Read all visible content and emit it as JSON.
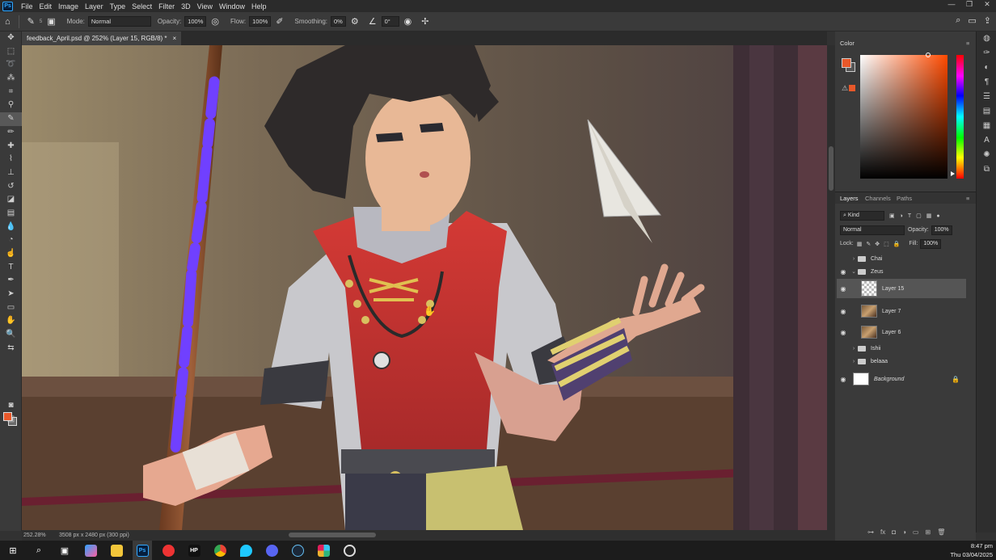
{
  "app": {
    "logo": "Ps"
  },
  "menu": [
    "File",
    "Edit",
    "Image",
    "Layer",
    "Type",
    "Select",
    "Filter",
    "3D",
    "View",
    "Window",
    "Help"
  ],
  "window_controls": [
    "—",
    "❐",
    "✕"
  ],
  "options": {
    "mode_label": "Mode:",
    "mode_value": "Normal",
    "opacity_label": "Opacity:",
    "opacity_value": "100%",
    "flow_label": "Flow:",
    "flow_value": "100%",
    "smoothing_label": "Smoothing:",
    "smoothing_value": "0%",
    "angle_value": "0°",
    "brush_size": "5"
  },
  "document": {
    "tab_title": "feedback_April.psd @ 252% (Layer 15, RGB/8) *",
    "close": "×"
  },
  "status": {
    "zoom": "252.28%",
    "dims": "3508 px x 2480 px (300 ppi)"
  },
  "color_panel": {
    "title": "Color",
    "foreground": "#e8582a",
    "hue": "#ff4a00"
  },
  "layers_panel": {
    "tabs": [
      "Layers",
      "Channels",
      "Paths"
    ],
    "kind": "Kind",
    "blend": "Normal",
    "opacity_label": "Opacity:",
    "opacity_value": "100%",
    "lock_label": "Lock:",
    "fill_label": "Fill:",
    "fill_value": "100%",
    "layers": [
      {
        "name": "Chai",
        "type": "group",
        "visible": false
      },
      {
        "name": "Zeus",
        "type": "group-open",
        "visible": true
      },
      {
        "name": "Layer 15",
        "type": "layer",
        "visible": true,
        "selected": true
      },
      {
        "name": "Layer 7",
        "type": "layer",
        "visible": true
      },
      {
        "name": "Layer 6",
        "type": "layer",
        "visible": true
      },
      {
        "name": "Ishii",
        "type": "group",
        "visible": false
      },
      {
        "name": "belaaa",
        "type": "group",
        "visible": false
      },
      {
        "name": "Background",
        "type": "background",
        "visible": true
      }
    ]
  },
  "taskbar": {
    "time": "8:47 pm",
    "date": "Thu 03/04/2025"
  }
}
